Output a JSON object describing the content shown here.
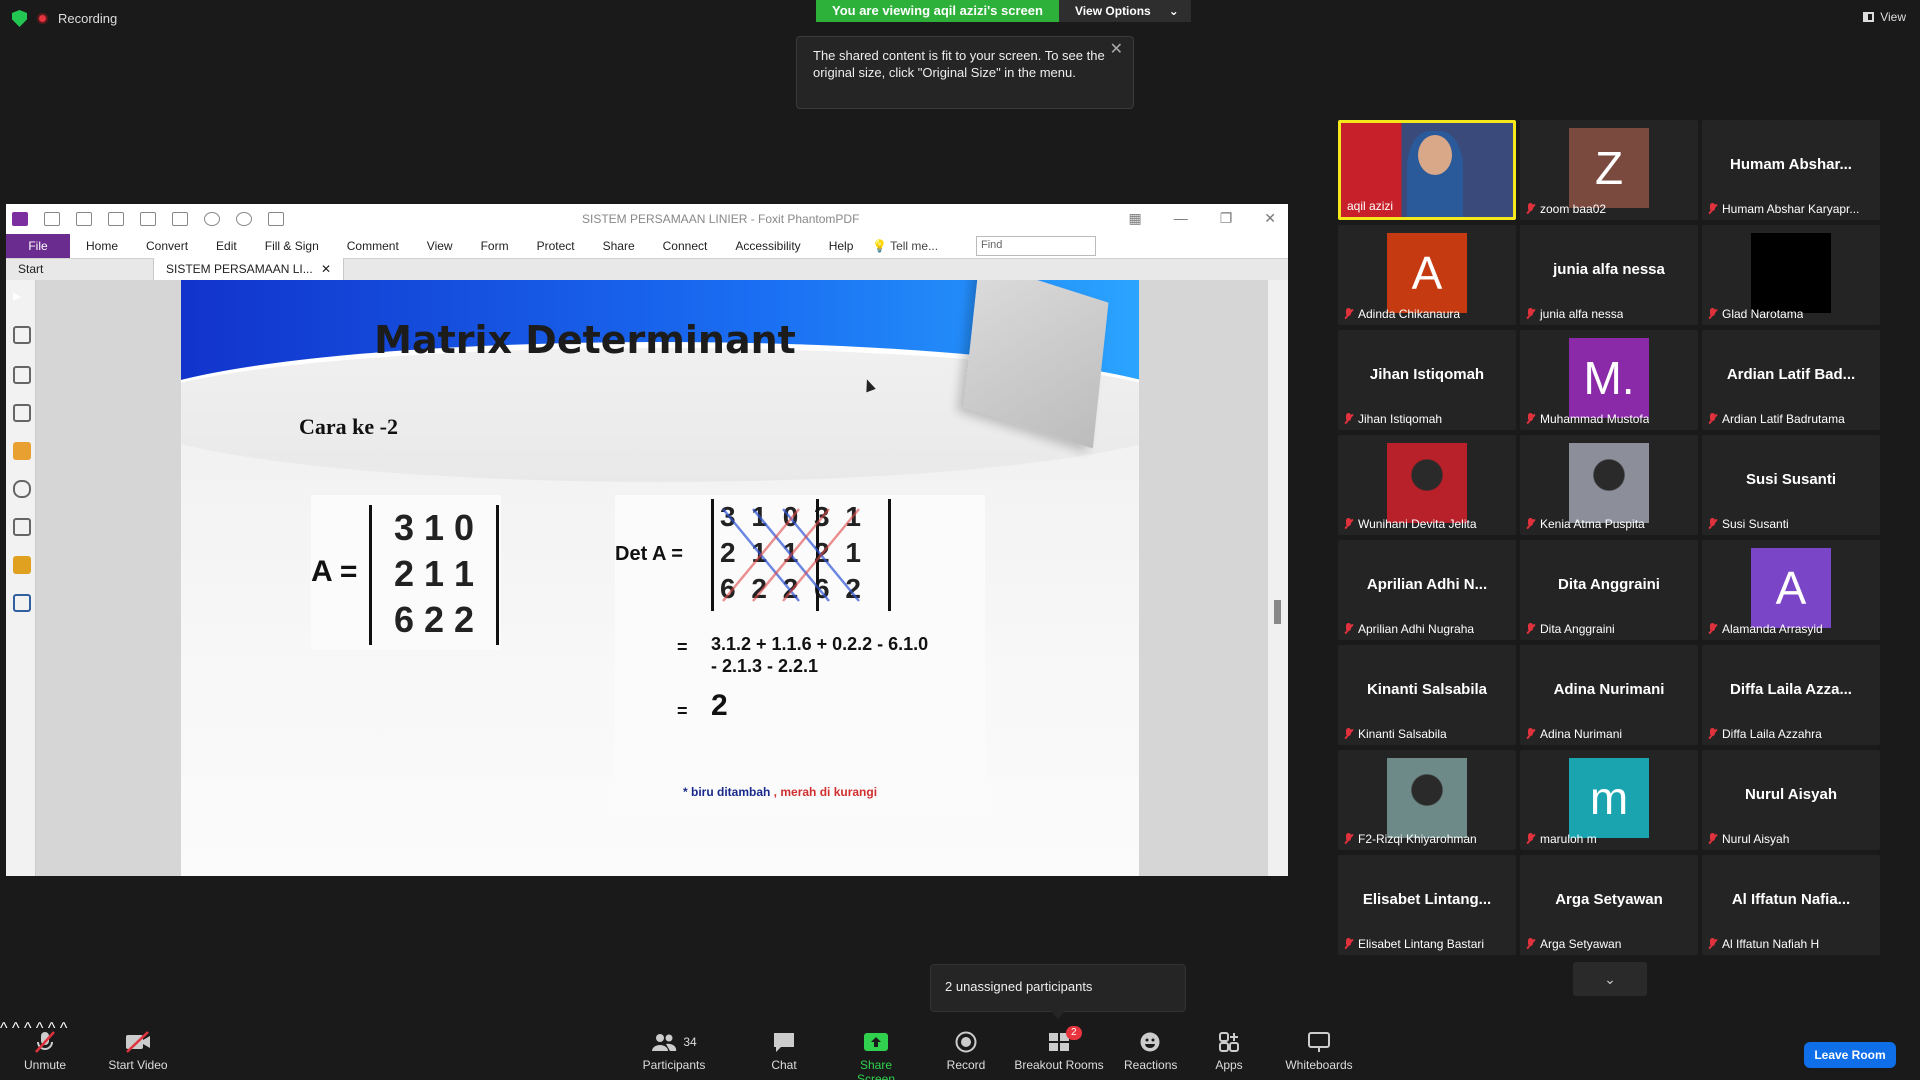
{
  "top": {
    "recording_label": "Recording",
    "viewing_label": "You are viewing aqil azizi's screen",
    "view_options_label": "View Options",
    "view_label": "View",
    "tooltip_text": "The shared content is fit to your screen. To see the original size, click \"Original Size\" in the menu."
  },
  "foxit": {
    "window_title": "SISTEM PERSAMAAN LINIER - Foxit PhantomPDF",
    "menu": [
      "File",
      "Home",
      "Convert",
      "Edit",
      "Fill & Sign",
      "Comment",
      "View",
      "Form",
      "Protect",
      "Share",
      "Connect",
      "Accessibility",
      "Help"
    ],
    "tell_me": "Tell me...",
    "find_placeholder": "Find",
    "tabs": [
      "Start",
      "SISTEM PERSAMAAN LI..."
    ]
  },
  "slide": {
    "title": "Matrix Determinant",
    "subtitle": "Cara ke -2",
    "matrix_label": "A =",
    "matrix_rows": [
      "3 1 0",
      "2 1 1",
      "6 2 2"
    ],
    "det_label": "Det A =",
    "det_rows": [
      "3 1 0 3 1",
      "2 1 1 2 1",
      "6 2 2 6 2"
    ],
    "eq_sign": "=",
    "eq_line1": "3.1.2 + 1.1.6 + 0.2.2 - 6.1.0",
    "eq_line2": "- 2.1.3 - 2.2.1",
    "eq_result": "2",
    "note_blue": "* biru ditambah",
    "note_sep": " , ",
    "note_red": "merah di kurangi"
  },
  "participants": [
    {
      "display": "aqil azizi",
      "name": "aqil azizi",
      "type": "video",
      "speaking": true
    },
    {
      "display": "Z",
      "name": "zoom baa02",
      "type": "avatar",
      "color": "#7a4a3e"
    },
    {
      "display": "Humam  Abshar...",
      "name": "Humam Abshar Karyapr...",
      "type": "text"
    },
    {
      "display": "A",
      "name": "Adinda Chikanaura",
      "type": "avatar",
      "color": "#c63a12"
    },
    {
      "display": "junia alfa nessa",
      "name": "junia alfa nessa",
      "type": "text"
    },
    {
      "display": "",
      "name": "Glad Narotama",
      "type": "black"
    },
    {
      "display": "Jihan Istiqomah",
      "name": "Jihan Istiqomah",
      "type": "text"
    },
    {
      "display": "M.",
      "name": "Muhammad Mustofa",
      "type": "avatar",
      "color": "#8a2aa8"
    },
    {
      "display": "Ardian Latif Bad...",
      "name": "Ardian Latif Badrutama",
      "type": "text"
    },
    {
      "display": "",
      "name": "Wunihani Devita Jelita",
      "type": "photo",
      "color": "#b8202a"
    },
    {
      "display": "",
      "name": "Kenia Atma Puspita",
      "type": "photo",
      "color": "#8c8f9a"
    },
    {
      "display": "Susi Susanti",
      "name": "Susi Susanti",
      "type": "text"
    },
    {
      "display": "Aprilian Adhi N...",
      "name": "Aprilian Adhi Nugraha",
      "type": "text"
    },
    {
      "display": "Dita Anggraini",
      "name": "Dita Anggraini",
      "type": "text"
    },
    {
      "display": "A",
      "name": "Alamanda Arrasyid",
      "type": "avatar",
      "color": "#7b45c8"
    },
    {
      "display": "Kinanti Salsabila",
      "name": "Kinanti Salsabila",
      "type": "text"
    },
    {
      "display": "Adina Nurimani",
      "name": "Adina Nurimani",
      "type": "text"
    },
    {
      "display": "Diffa Laila Azza...",
      "name": "Diffa Laila Azzahra",
      "type": "text"
    },
    {
      "display": "",
      "name": "F2-Rizqi Khiyarohman",
      "type": "photo",
      "color": "#6e8a88"
    },
    {
      "display": "m",
      "name": "maruloh m",
      "type": "avatar",
      "color": "#1aa4b0"
    },
    {
      "display": "Nurul Aisyah",
      "name": "Nurul Aisyah",
      "type": "text"
    },
    {
      "display": "Elisabet  Lintang...",
      "name": "Elisabet Lintang Bastari",
      "type": "text"
    },
    {
      "display": "Arga Setyawan",
      "name": "Arga Setyawan",
      "type": "text"
    },
    {
      "display": "Al Iffatun Nafia...",
      "name": "Al Iffatun Nafiah H",
      "type": "text"
    }
  ],
  "unassigned": "2 unassigned participants",
  "toolbar": {
    "unmute": "Unmute",
    "start_video": "Start Video",
    "participants": "Participants",
    "participants_count": "34",
    "chat": "Chat",
    "share_screen": "Share Screen",
    "record": "Record",
    "breakout_rooms": "Breakout Rooms",
    "breakout_badge": "2",
    "reactions": "Reactions",
    "apps": "Apps",
    "whiteboards": "Whiteboards",
    "leave_room": "Leave Room"
  }
}
